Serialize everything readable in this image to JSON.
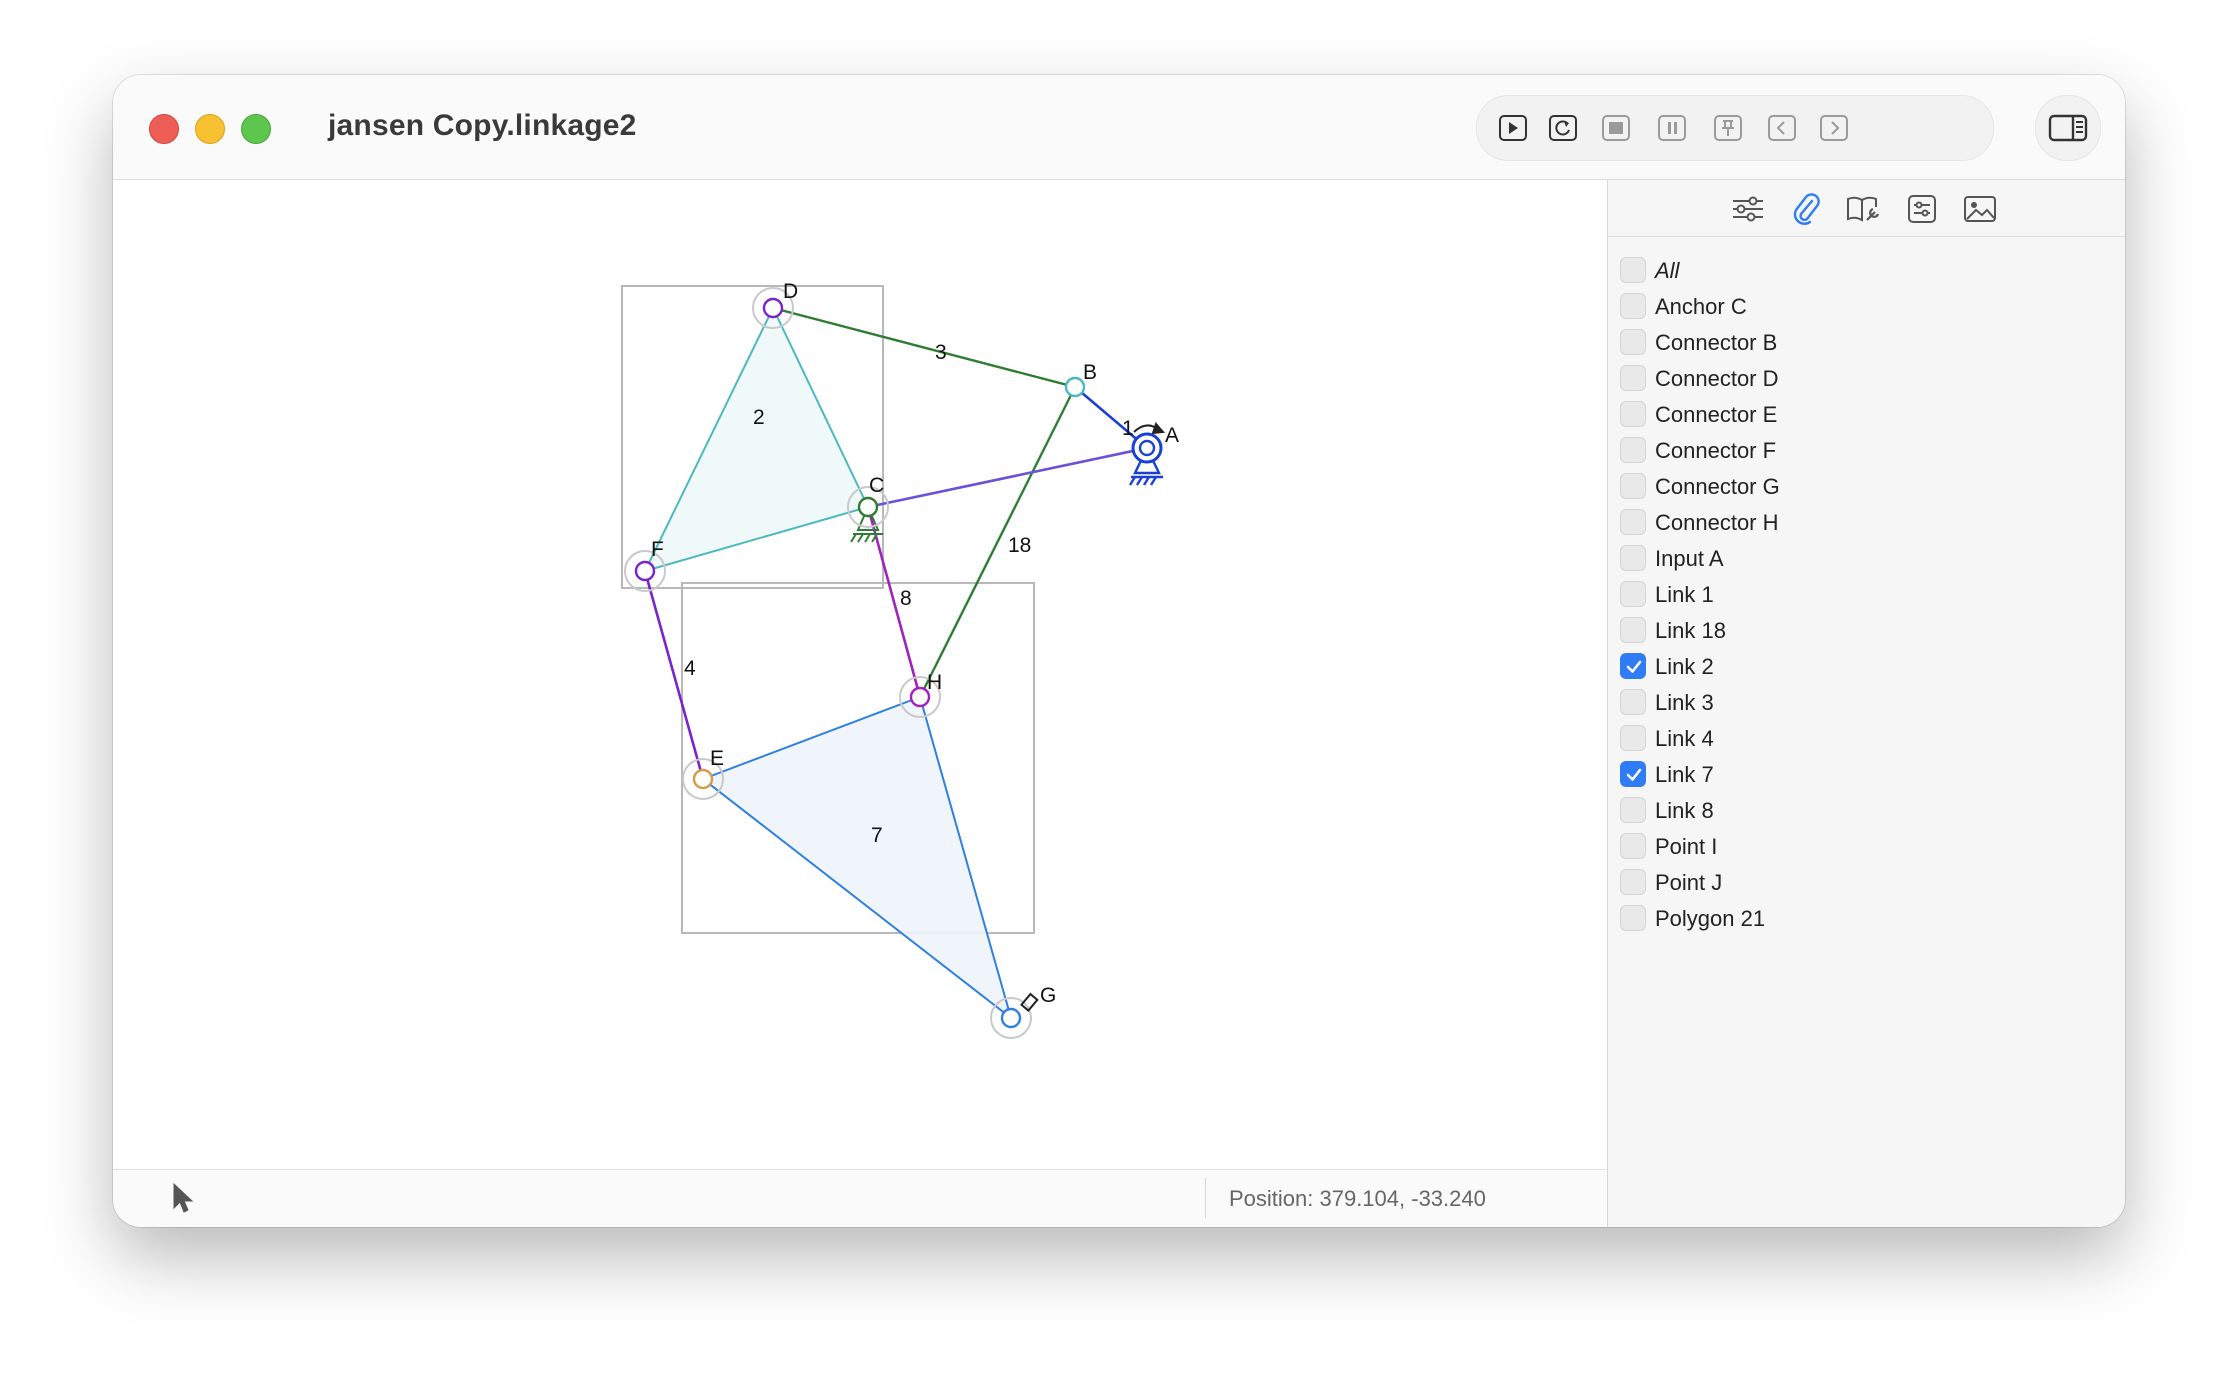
{
  "window": {
    "title": "jansen Copy.linkage2"
  },
  "toolbar": {
    "buttons": [
      {
        "name": "play-button",
        "icon": "play-icon"
      },
      {
        "name": "restart-button",
        "icon": "restart-icon"
      },
      {
        "name": "stop-button",
        "icon": "stop-icon"
      },
      {
        "name": "pause-button",
        "icon": "pause-icon"
      },
      {
        "name": "pin-button",
        "icon": "pin-icon"
      },
      {
        "name": "step-back-button",
        "icon": "chevron-left-icon"
      },
      {
        "name": "step-forward-button",
        "icon": "chevron-right-icon"
      }
    ],
    "sidebar_toggle_icon": "sidebar-icon"
  },
  "panel": {
    "tabs": [
      {
        "name": "tab-adjust",
        "icon": "sliders-icon"
      },
      {
        "name": "tab-attach",
        "icon": "paperclip-icon",
        "active": true
      },
      {
        "name": "tab-book",
        "icon": "book-wrench-icon"
      },
      {
        "name": "tab-settings",
        "icon": "settings-box-icon"
      },
      {
        "name": "tab-image",
        "icon": "image-icon"
      }
    ],
    "items": [
      {
        "label": "All",
        "checked": false,
        "italic": true
      },
      {
        "label": "Anchor C",
        "checked": false
      },
      {
        "label": "Connector B",
        "checked": false
      },
      {
        "label": "Connector D",
        "checked": false
      },
      {
        "label": "Connector E",
        "checked": false
      },
      {
        "label": "Connector F",
        "checked": false
      },
      {
        "label": "Connector G",
        "checked": false
      },
      {
        "label": "Connector H",
        "checked": false
      },
      {
        "label": "Input A",
        "checked": false
      },
      {
        "label": "Link 1",
        "checked": false
      },
      {
        "label": "Link 18",
        "checked": false
      },
      {
        "label": "Link 2",
        "checked": true
      },
      {
        "label": "Link 3",
        "checked": false
      },
      {
        "label": "Link 4",
        "checked": false
      },
      {
        "label": "Link 7",
        "checked": true
      },
      {
        "label": "Link 8",
        "checked": false
      },
      {
        "label": "Point I",
        "checked": false
      },
      {
        "label": "Point J",
        "checked": false
      },
      {
        "label": "Polygon 21",
        "checked": false
      }
    ]
  },
  "status": {
    "position": "Position: 379.104, -33.240"
  },
  "diagram": {
    "joint_labels": {
      "A": "A",
      "B": "B",
      "C": "C",
      "D": "D",
      "E": "E",
      "F": "F",
      "G": "G",
      "H": "H"
    },
    "link_labels": {
      "l1": "1",
      "l2": "2",
      "l3": "3",
      "l4": "4",
      "l7": "7",
      "l8": "8",
      "l18": "18"
    },
    "colors": {
      "link2": "#4db8c0",
      "link3": "#2e7d32",
      "link18": "#2e7d32",
      "link1": "#1a3fd6",
      "link8": "#a020c0",
      "link4": "#7a22d0",
      "link7": "#2f80e0",
      "accent": "#2f7cf6"
    }
  }
}
